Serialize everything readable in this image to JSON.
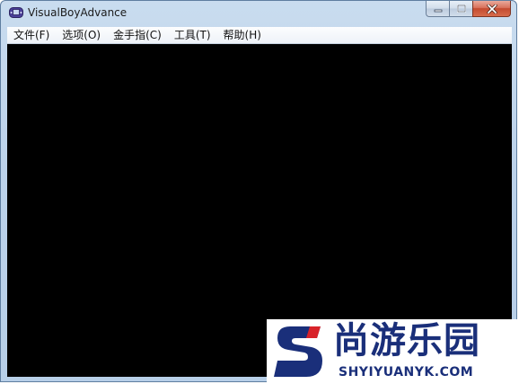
{
  "window": {
    "title": "VisualBoyAdvance",
    "app_icon": "gameboy-advance-icon",
    "controls": {
      "minimize": "minimize-icon",
      "maximize": "maximize-icon",
      "close": "close-icon"
    }
  },
  "menubar": {
    "items": [
      {
        "label": "文件(F)"
      },
      {
        "label": "选项(O)"
      },
      {
        "label": "金手指(C)"
      },
      {
        "label": "工具(T)"
      },
      {
        "label": "帮助(H)"
      }
    ]
  },
  "screen": {
    "background": "#000000"
  },
  "watermark": {
    "title": "尚游乐园",
    "url": "SHYIYUANYK.COM",
    "colors": {
      "logo_blue": "#1a2f7a",
      "logo_red": "#d8232a"
    }
  }
}
